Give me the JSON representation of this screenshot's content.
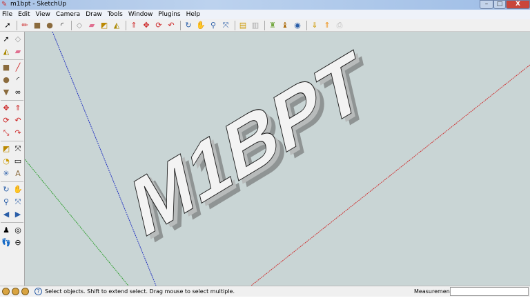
{
  "window": {
    "title": "m1bpt - SketchUp",
    "min": "–",
    "max": "□",
    "close": "X"
  },
  "menu": [
    "File",
    "Edit",
    "View",
    "Camera",
    "Draw",
    "Tools",
    "Window",
    "Plugins",
    "Help"
  ],
  "toolbar_icons": [
    "select",
    "eraser-x",
    "pencil",
    "rectangle",
    "circle",
    "arc",
    "make-component",
    "eraser",
    "tape-measure",
    "paint-bucket",
    "push-pull",
    "move",
    "rotate",
    "follow-me",
    "orbit",
    "pan",
    "zoom",
    "zoom-extents",
    "get-models",
    "share-model",
    "component",
    "get-photo-texture",
    "google-earth",
    "download",
    "upload",
    "print"
  ],
  "model_text": "M1BPT",
  "status": {
    "message": "Select objects. Shift to extend select. Drag mouse to select multiple.",
    "measurements_label": "Measurements",
    "measurements_value": ""
  },
  "colors": {
    "canvas": "#c9d5d5",
    "red_axis": "#d03030",
    "green_axis": "#30a030",
    "blue_axis": "#2030c0"
  }
}
